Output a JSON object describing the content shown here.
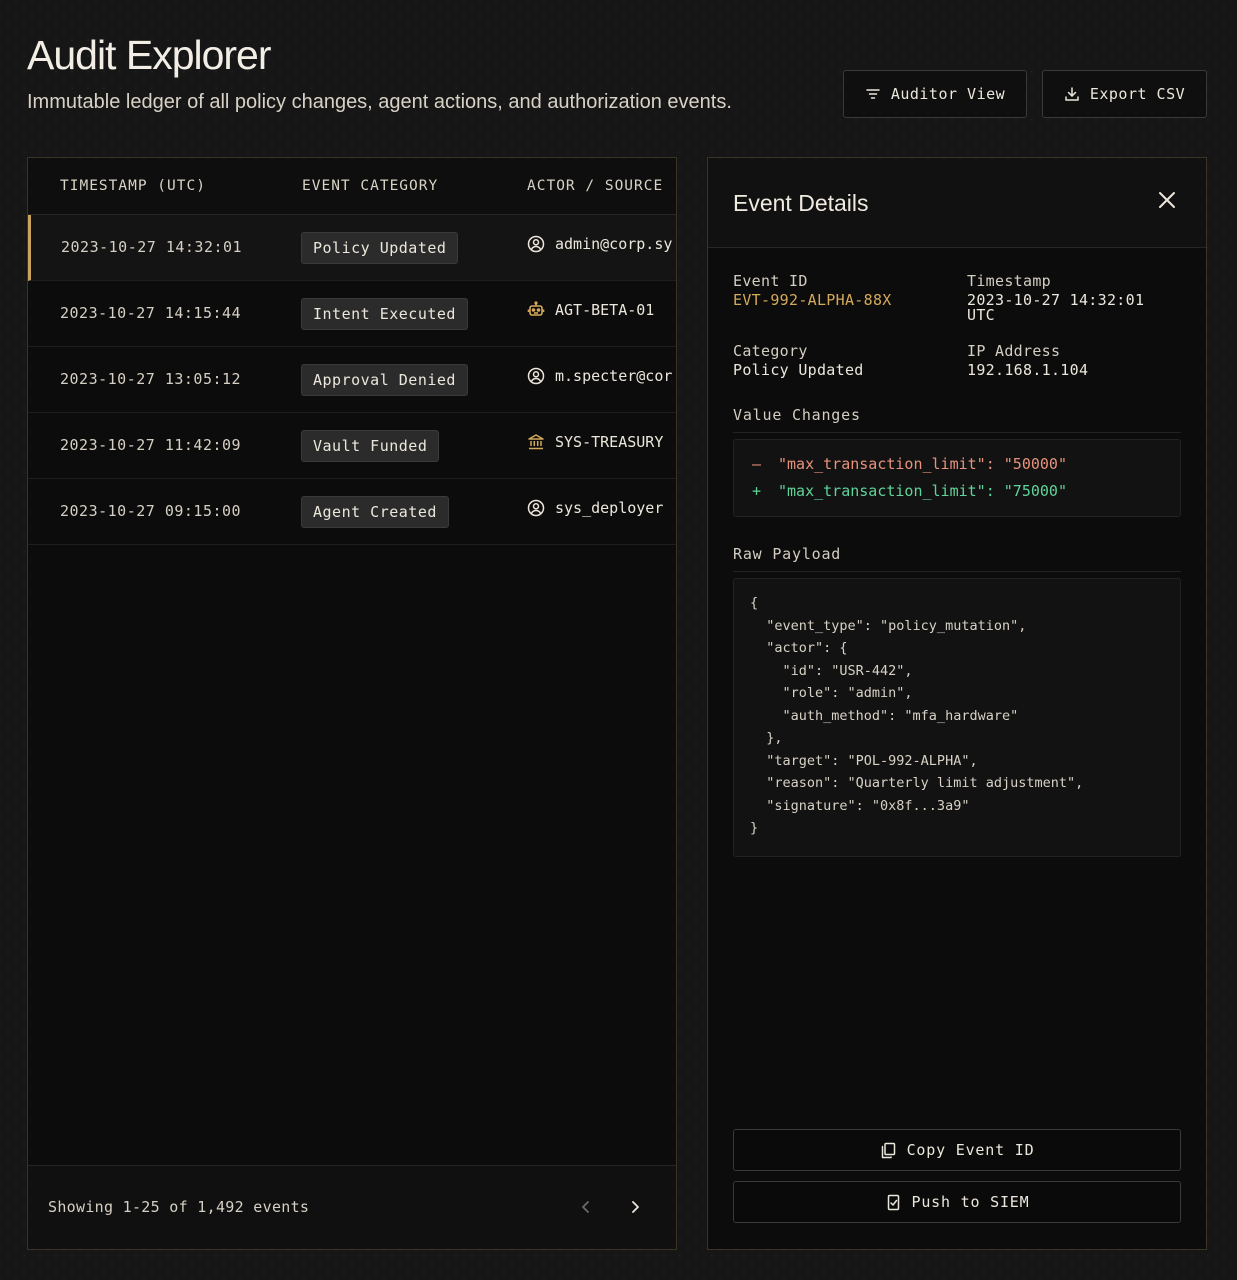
{
  "header": {
    "title": "Audit Explorer",
    "subtitle": "Immutable ledger of all policy changes, agent actions, and authorization events.",
    "auditor_view_label": "Auditor View",
    "export_label": "Export CSV"
  },
  "table": {
    "columns": [
      "TIMESTAMP (UTC)",
      "EVENT CATEGORY",
      "ACTOR / SOURCE"
    ],
    "rows": [
      {
        "timestamp": "2023-10-27 14:32:01",
        "category": "Policy Updated",
        "actor": "admin@corp.sy",
        "actor_icon": "user-circle-icon"
      },
      {
        "timestamp": "2023-10-27 14:15:44",
        "category": "Intent Executed",
        "actor": "AGT-BETA-01",
        "actor_icon": "robot-icon"
      },
      {
        "timestamp": "2023-10-27 13:05:12",
        "category": "Approval Denied",
        "actor": "m.specter@cor",
        "actor_icon": "user-circle-icon"
      },
      {
        "timestamp": "2023-10-27 11:42:09",
        "category": "Vault Funded",
        "actor": "SYS-TREASURY",
        "actor_icon": "bank-icon"
      },
      {
        "timestamp": "2023-10-27 09:15:00",
        "category": "Agent Created",
        "actor": "sys_deployer",
        "actor_icon": "user-circle-icon"
      }
    ],
    "footer_text": "Showing 1-25 of 1,492 events"
  },
  "detail": {
    "title": "Event Details",
    "event_id_label": "Event ID",
    "event_id": "EVT-992-ALPHA-88X",
    "timestamp_label": "Timestamp",
    "timestamp_line1": "2023-10-27 14:32:01",
    "timestamp_line2": "UTC",
    "category_label": "Category",
    "category": "Policy Updated",
    "ip_label": "IP Address",
    "ip": "192.168.1.104",
    "value_changes_label": "Value Changes",
    "diff_minus_sign": "—",
    "diff_minus": "\"max_transaction_limit\": \"50000\"",
    "diff_plus_sign": "+",
    "diff_plus": "\"max_transaction_limit\": \"75000\"",
    "raw_payload_label": "Raw Payload",
    "payload_lines": [
      "{",
      "  \"event_type\": \"policy_mutation\",",
      "  \"actor\": {",
      "    \"id\": \"USR-442\",",
      "    \"role\": \"admin\",",
      "    \"auth_method\": \"mfa_hardware\"",
      "  },",
      "  \"target\": \"POL-992-ALPHA\",",
      "  \"reason\": \"Quarterly limit adjustment\",",
      "  \"signature\": \"0x8f...3a9\"",
      "}"
    ],
    "copy_label": "Copy Event ID",
    "siem_label": "Push to SIEM"
  },
  "colors": {
    "accent": "#c9a35b",
    "diff_minus": "#e8927c",
    "diff_plus": "#5fd49a"
  }
}
